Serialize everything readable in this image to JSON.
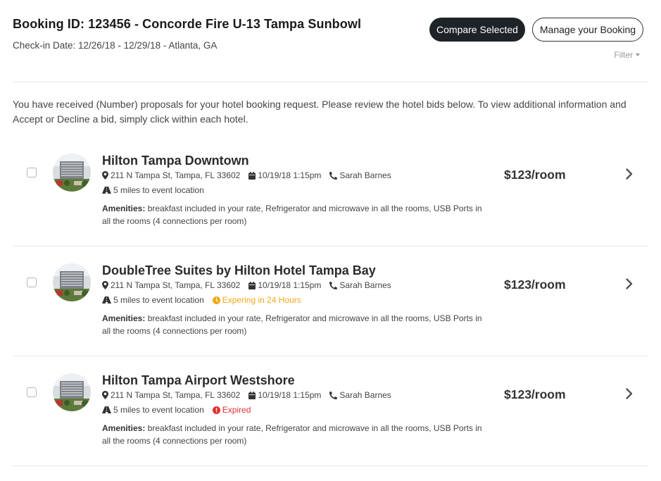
{
  "header": {
    "title": "Booking ID: 123456 - Concorde Fire U-13 Tampa Sunbowl",
    "subtitle": "Check-in Date: 12/26/18 - 12/29/18 - Atlanta, GA",
    "compare_label": "Compare Selected",
    "manage_label": "Manage your Booking",
    "filter_label": "Filter"
  },
  "intro": "You have received (Number) proposals for your hotel booking request. Please review the hotel bids below. To view additional information and Accept or Decline a bid, simply click within each hotel.",
  "colors": {
    "dark_button": "#1e2328",
    "warning": "#f0a818",
    "expired": "#e0312f"
  },
  "hotels": [
    {
      "name": "Hilton Tampa Downtown",
      "address": "211 N Tampa St, Tampa, FL 33602",
      "date": "10/19/18 1:15pm",
      "contact": "Sarah Barnes",
      "distance": "5 miles to event location",
      "status": "",
      "amenities_label": "Amenities:",
      "amenities": "breakfast included in your rate, Refrigerator and microwave in all the rooms, USB Ports in all the rooms (4 connections per room)",
      "price": "$123/room"
    },
    {
      "name": "DoubleTree Suites by Hilton Hotel Tampa Bay",
      "address": "211 N Tampa St, Tampa, FL 33602",
      "date": "10/19/18 1:15pm",
      "contact": "Sarah Barnes",
      "distance": "5 miles to event location",
      "status": "Expering in 24 Hours",
      "amenities_label": "Amenities:",
      "amenities": "breakfast included in your rate, Refrigerator and microwave in all the rooms, USB Ports in all the rooms (4 connections per room)",
      "price": "$123/room"
    },
    {
      "name": "Hilton Tampa Airport Westshore",
      "address": "211 N Tampa St, Tampa, FL 33602",
      "date": "10/19/18 1:15pm",
      "contact": "Sarah Barnes",
      "distance": "5 miles to event location",
      "status": "Expired",
      "amenities_label": "Amenities:",
      "amenities": "breakfast included in your rate, Refrigerator and microwave in all the rooms, USB Ports in all the rooms (4 connections per room)",
      "price": "$123/room"
    }
  ],
  "icons": {
    "address": "map-marker-icon",
    "date": "calendar-icon",
    "contact": "phone-icon",
    "distance": "road-icon",
    "warning": "clock-icon",
    "expired": "alert-circle-icon",
    "row": "chevron-right-icon"
  }
}
